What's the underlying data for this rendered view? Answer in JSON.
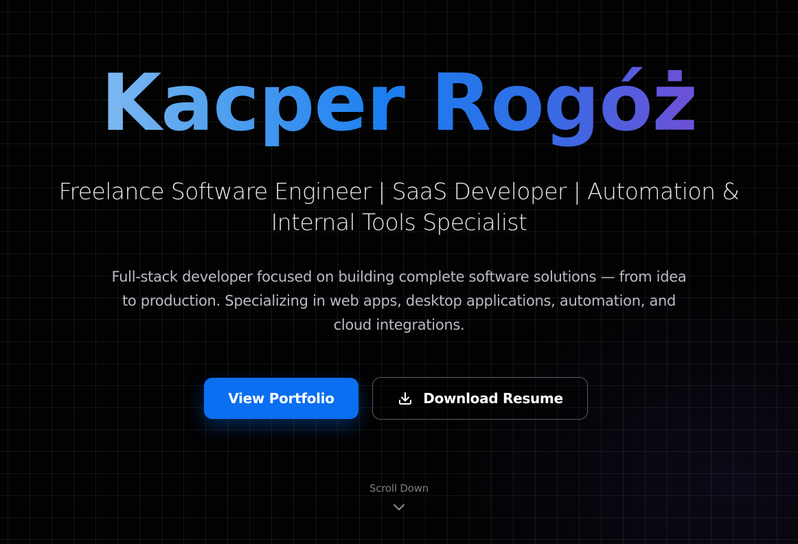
{
  "hero": {
    "name": "Kacper Rogóż",
    "tagline": "Freelance Software Engineer | SaaS Developer | Automation & Internal Tools Specialist",
    "description": "Full-stack developer focused on building complete software solutions — from idea to production. Specializing in web apps, desktop applications, automation, and cloud integrations.",
    "primary_button": "View Portfolio",
    "secondary_button": "Download Resume",
    "scroll_label": "Scroll Down"
  },
  "icons": {
    "download": "download-icon",
    "scroll": "chevron-down-icon"
  },
  "colors": {
    "background": "#020203",
    "primary_button": "#0a6ff0",
    "gradient_start": "#a9cdf5",
    "gradient_mid": "#1b7ff0",
    "gradient_end": "#7a4fd6"
  }
}
